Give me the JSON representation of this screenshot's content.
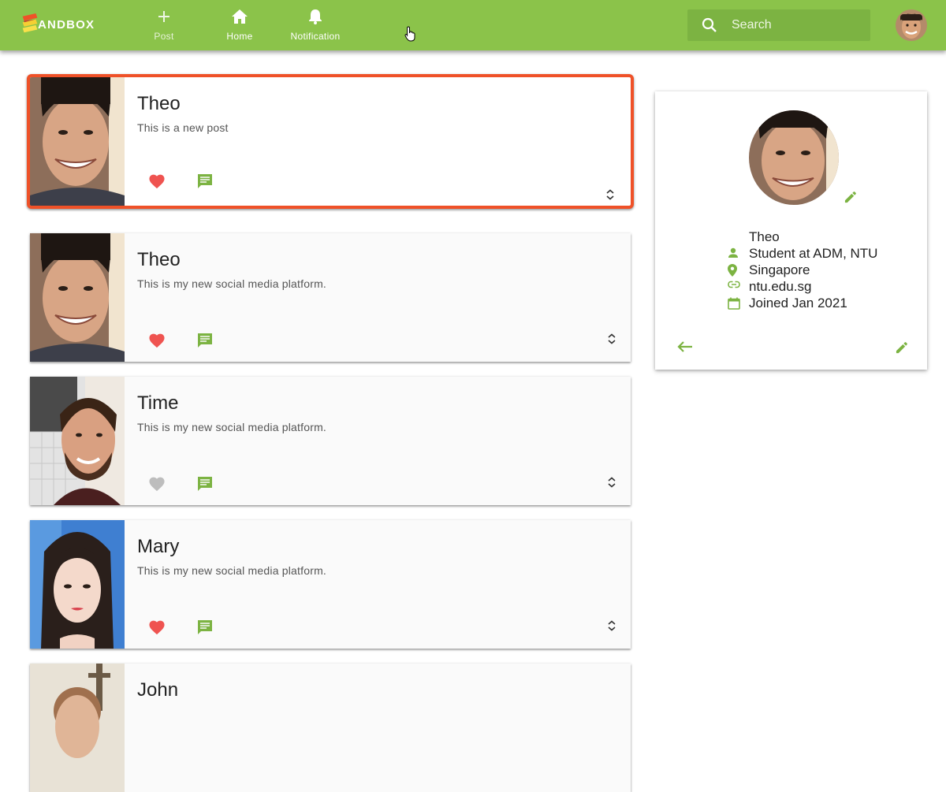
{
  "app": {
    "logo_text": "ANDBOX",
    "brand_color": "#8bc34a",
    "accent_color": "#7cb342",
    "highlight_color": "#ef5128",
    "like_color": "#ef5350"
  },
  "nav": {
    "post_label": "Post",
    "home_label": "Home",
    "notification_label": "Notification"
  },
  "search": {
    "placeholder": "Search"
  },
  "posts": [
    {
      "author": "Theo",
      "text": "This is a new post",
      "liked": true,
      "icon": "heart-icon"
    },
    {
      "author": "Theo",
      "text": "This is my new social media platform.",
      "liked": true,
      "icon": "heart-icon"
    },
    {
      "author": "Time",
      "text": "This is my new social media platform.",
      "liked": false,
      "icon": "heart-icon"
    },
    {
      "author": "Mary",
      "text": "This is my new social media platform.",
      "liked": true,
      "icon": "heart-icon"
    },
    {
      "author": "John",
      "text": "",
      "liked": false,
      "icon": "heart-icon"
    }
  ],
  "profile": {
    "name": "Theo",
    "bio": "Student at ADM, NTU",
    "location": "Singapore",
    "website": "ntu.edu.sg",
    "joined": "Joined Jan 2021"
  }
}
